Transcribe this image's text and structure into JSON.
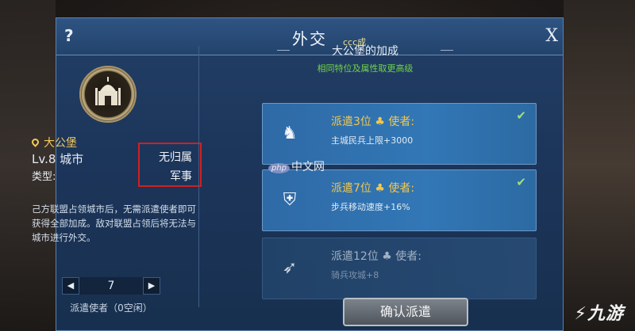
{
  "window": {
    "title": "外交",
    "help_label": "?",
    "close_label": "X"
  },
  "city": {
    "name": "大公堡",
    "level": "Lv.8 城市",
    "type_label": "类型:",
    "faction_status": "无归属",
    "faction_type": "军事",
    "description": "己方联盟占领城市后，无需派遣使者即可获得全部加成。敌对联盟占领后将无法与城市进行外交。"
  },
  "stepper": {
    "value": "7",
    "left_arrow": "◀",
    "right_arrow": "▶"
  },
  "envoy_label": "派遣使者（0空闲）",
  "bonus": {
    "title": "大公堡的加成",
    "subtitle": "相同特位及属性取更高级",
    "tiers": [
      {
        "title": "派遣3位 ♣ 使者:",
        "effect": "主城民兵上限+3000",
        "completed": true,
        "icon": "cavalry-icon"
      },
      {
        "title": "派遣7位 ♣ 使者:",
        "effect": "步兵移动速度+16%",
        "completed": true,
        "icon": "infantry-icon"
      },
      {
        "title": "派遣12位 ♣ 使者:",
        "effect": "骑兵攻城+8",
        "completed": false,
        "icon": "archer-icon"
      }
    ]
  },
  "confirm_label": "确认派遣",
  "watermarks": {
    "top_mini": "ccc成",
    "php_site": "中文网",
    "php_badge": "php",
    "brand": "九游"
  },
  "colors": {
    "panel": "#1c355a",
    "accent_gold": "#f2c74e",
    "bonus_green": "#6fd24a",
    "highlight_red": "#d02020"
  }
}
